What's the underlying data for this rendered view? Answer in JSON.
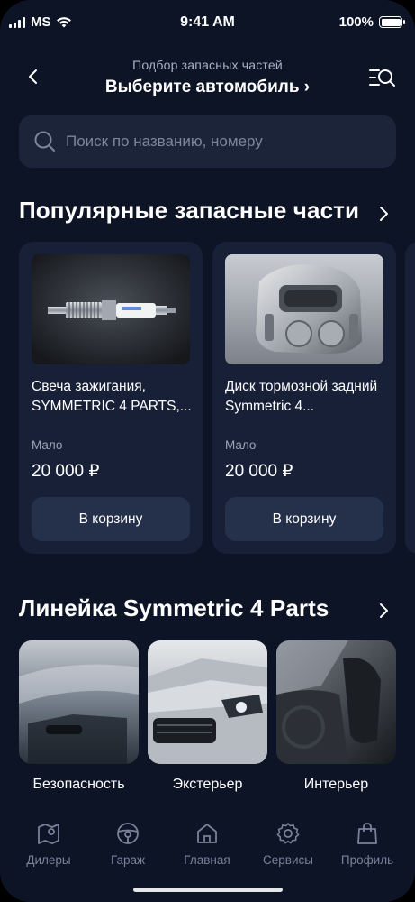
{
  "status_bar": {
    "carrier": "MS",
    "time": "9:41 AM",
    "battery": "100%"
  },
  "header": {
    "subtitle": "Подбор запасных частей",
    "title": "Выберите автомобиль ›"
  },
  "search": {
    "placeholder": "Поиск по названию, номеру"
  },
  "popular": {
    "title": "Популярные запасные части",
    "products": [
      {
        "name": "Свеча зажигания, SYMMETRIC 4 PARTS,...",
        "stock": "Мало",
        "price": "20 000 ₽",
        "button": "В корзину",
        "image": "spark-plug-photo"
      },
      {
        "name": "Диск тормозной задний Symmetric 4...",
        "stock": "Мало",
        "price": "20 000 ₽",
        "button": "В корзину",
        "image": "brake-caliper-photo"
      }
    ]
  },
  "lineup": {
    "title": "Линейка Symmetric 4 Parts",
    "categories": [
      {
        "label": "Безопасность",
        "image": "car-glass-photo"
      },
      {
        "label": "Экстерьер",
        "image": "car-front-photo"
      },
      {
        "label": "Интерьер",
        "image": "car-interior-photo"
      }
    ]
  },
  "tabbar": {
    "items": [
      {
        "label": "Дилеры",
        "icon": "map-pin-icon"
      },
      {
        "label": "Гараж",
        "icon": "steering-wheel-icon"
      },
      {
        "label": "Главная",
        "icon": "home-icon"
      },
      {
        "label": "Сервисы",
        "icon": "gear-icon"
      },
      {
        "label": "Профиль",
        "icon": "shopping-bag-icon"
      }
    ]
  },
  "colors": {
    "background": "#0c1426",
    "card": "#172037",
    "button": "#25304a",
    "muted_text": "#79829a"
  }
}
